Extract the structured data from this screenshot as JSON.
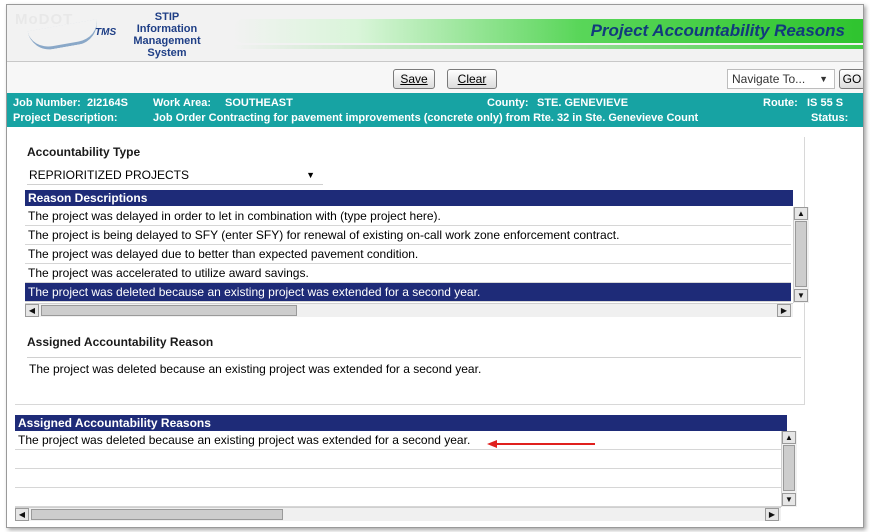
{
  "header": {
    "logo_text": "MoDOT",
    "logo_tms": "TMS",
    "system_line1": "STIP",
    "system_line2": "Information",
    "system_line3": "Management System",
    "page_title": "Project Accountability Reasons"
  },
  "toolbar": {
    "save_label": "Save",
    "clear_label": "Clear",
    "navigate_value": "Navigate To...",
    "go_label": "GO"
  },
  "info": {
    "job_number_label": "Job Number:",
    "job_number": "2I2164S",
    "work_area_label": "Work Area:",
    "work_area": "SOUTHEAST",
    "county_label": "County:",
    "county": "STE. GENEVIEVE",
    "route_label": "Route:",
    "route": "IS 55 S",
    "description_label": "Project Description:",
    "description": "Job Order Contracting for pavement improvements (concrete only) from Rte. 32 in Ste. Genevieve Count",
    "status_label": "Status:"
  },
  "accountability_type": {
    "label": "Accountability Type",
    "selected": "REPRIORITIZED PROJECTS"
  },
  "reason_descriptions": {
    "header": "Reason Descriptions",
    "rows": [
      "The project was delayed in order to let in combination with (type project here).",
      "The project is being delayed to SFY (enter SFY)  for renewal of existing on-call work zone enforcement contract.",
      "The project was delayed due to better than expected pavement condition.",
      "The project was accelerated to utilize award savings.",
      "The project was deleted because an existing project was extended for a second year."
    ],
    "selected_index": 4
  },
  "assigned_reason": {
    "label": "Assigned Accountability Reason",
    "text": "The project was deleted because an existing project was extended for a second year."
  },
  "assigned_reasons_grid": {
    "header": "Assigned Accountability Reasons",
    "rows": [
      "The project was deleted because an existing project was extended for a second year.",
      "",
      "",
      ""
    ]
  },
  "colors": {
    "teal_bar": "#17a3a3",
    "grid_header": "#1e2b78",
    "arrow": "#e0201e"
  }
}
